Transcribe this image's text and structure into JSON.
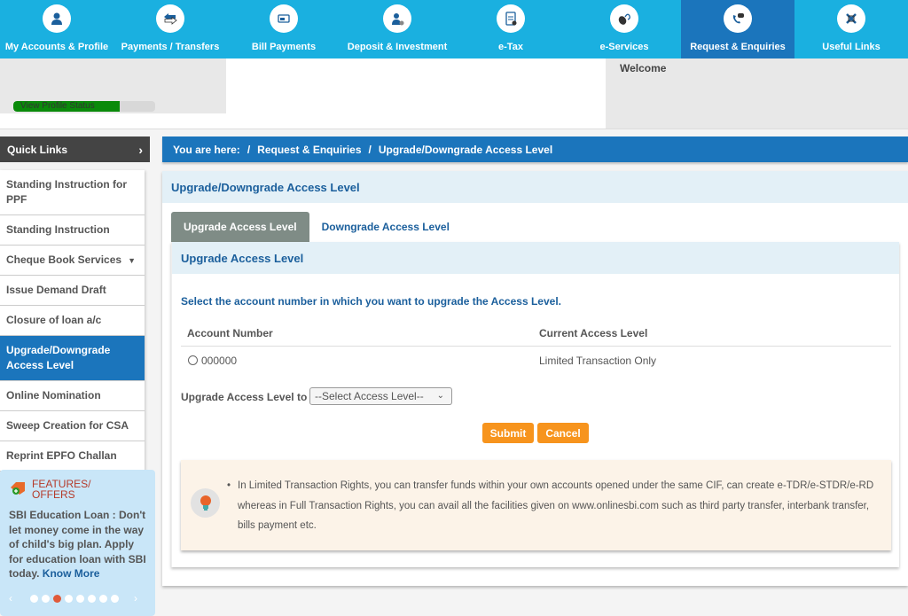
{
  "topnav": {
    "items": [
      {
        "label": "My Accounts & Profile",
        "icon": "user-icon"
      },
      {
        "label": "Payments / Transfers",
        "icon": "transfer-icon"
      },
      {
        "label": "Bill Payments",
        "icon": "bill-icon"
      },
      {
        "label": "Deposit & Investment",
        "icon": "deposit-icon"
      },
      {
        "label": "e-Tax",
        "icon": "tax-document-icon"
      },
      {
        "label": "e-Services",
        "icon": "mouse-icon"
      },
      {
        "label": "Request & Enquiries",
        "icon": "phone-chat-icon"
      },
      {
        "label": "Useful Links",
        "icon": "links-icon"
      }
    ],
    "active_index": 6,
    "bg_color": "#1ab0e0",
    "active_color": "#1b75bc"
  },
  "header": {
    "profile_status_label": "View Profile Status",
    "profile_progress_percent": 75,
    "welcome": "Welcome"
  },
  "sidebar": {
    "quick_links_label": "Quick Links",
    "items": [
      {
        "label": "Standing Instruction for PPF"
      },
      {
        "label": "Standing Instruction"
      },
      {
        "label": "Cheque Book Services",
        "has_dropdown": true
      },
      {
        "label": "Issue Demand Draft"
      },
      {
        "label": "Closure of loan a/c"
      },
      {
        "label": "Upgrade/Downgrade Access Level",
        "active": true
      },
      {
        "label": "Online Nomination"
      },
      {
        "label": "Sweep Creation for CSA"
      },
      {
        "label": "Reprint EPFO Challan"
      }
    ],
    "offers": {
      "title_line1": "FEATURES/",
      "title_line2": "OFFERS",
      "text": "SBI Education Loan : Don't let money come in the way of child's big plan. Apply for education loan with SBI today.",
      "link": "Know More",
      "dots_total": 8,
      "dots_active_index": 2
    }
  },
  "breadcrumb": {
    "prefix": "You are here:",
    "separator": "/",
    "items": [
      "Request & Enquiries",
      "Upgrade/Downgrade Access Level"
    ]
  },
  "main": {
    "title": "Upgrade/Downgrade Access Level",
    "tabs": [
      {
        "label": "Upgrade Access Level",
        "active": true
      },
      {
        "label": "Downgrade Access Level",
        "active": false
      }
    ],
    "panel_title": "Upgrade Access Level",
    "instruction": "Select the account number in which you want to upgrade the Access Level.",
    "table": {
      "headers": [
        "Account Number",
        "Current Access Level"
      ],
      "rows": [
        {
          "account": "000000",
          "level": "Limited Transaction Only",
          "selected": false
        }
      ]
    },
    "upgrade_label": "Upgrade Access Level to",
    "select_value": "--Select Access Level--",
    "submit_label": "Submit",
    "cancel_label": "Cancel",
    "note": "In Limited Transaction Rights, you can transfer funds within your own accounts opened under the same CIF, can create e-TDR/e-STDR/e-RD whereas in Full Transaction Rights, you can avail all the facilities given on www.onlinesbi.com such as third party transfer, interbank transfer, bills payment etc."
  }
}
